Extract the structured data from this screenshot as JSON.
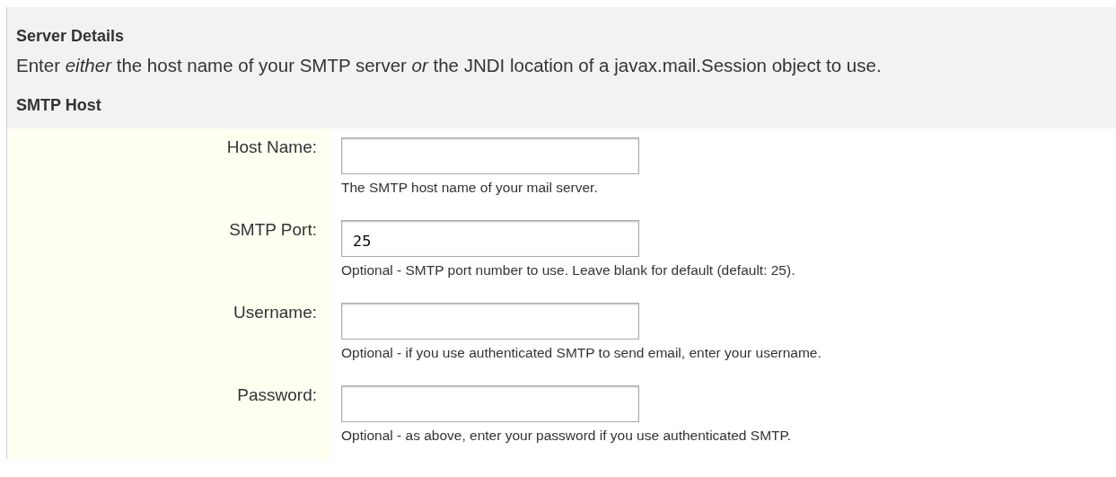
{
  "section": {
    "title": "Server Details",
    "description": "Enter *either* the host name of your SMTP server *or* the JNDI location of a javax.mail.Session object to use.",
    "subtitle": "SMTP Host"
  },
  "fields": [
    {
      "label": "Host Name:",
      "help": "The SMTP host name of your mail server."
    },
    {
      "label": "SMTP Port:",
      "value": "25",
      "help": "Optional - SMTP port number to use. Leave blank for default (default: 25)."
    },
    {
      "label": "Username:",
      "help": "Optional - if you use authenticated SMTP to send email, enter your username."
    },
    {
      "label": "Password:",
      "help": "Optional - as above, enter your password if you use authenticated SMTP."
    }
  ]
}
